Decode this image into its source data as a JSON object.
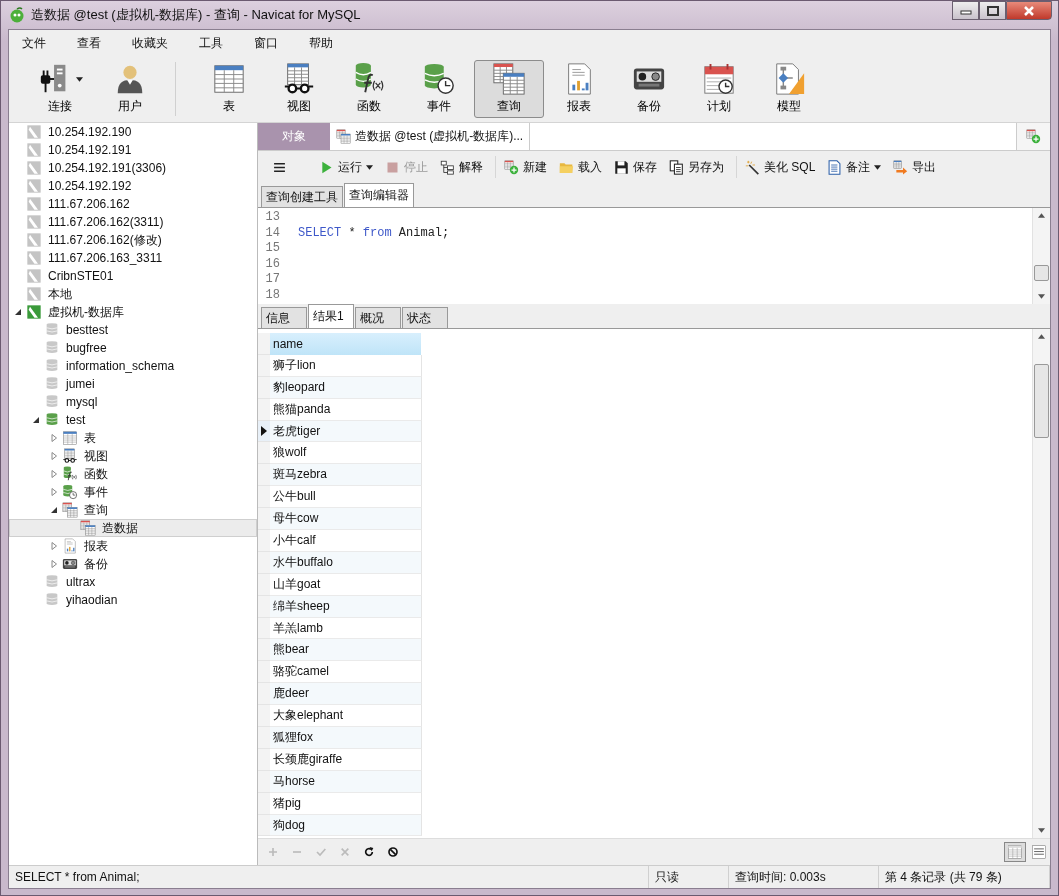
{
  "window": {
    "title": "造数据 @test (虚拟机-数据库) - 查询 - Navicat for MySQL"
  },
  "menu": [
    "文件",
    "查看",
    "收藏夹",
    "工具",
    "窗口",
    "帮助"
  ],
  "toolbar": {
    "groups": [
      [
        {
          "label": "连接",
          "kind": "connection",
          "dropdown": true,
          "selected": false
        },
        {
          "label": "用户",
          "kind": "user",
          "dropdown": false,
          "selected": false
        }
      ],
      [
        {
          "label": "表",
          "kind": "table",
          "dropdown": false,
          "selected": false
        },
        {
          "label": "视图",
          "kind": "view",
          "dropdown": false,
          "selected": false
        },
        {
          "label": "函数",
          "kind": "function",
          "dropdown": false,
          "selected": false
        },
        {
          "label": "事件",
          "kind": "event",
          "dropdown": false,
          "selected": false
        },
        {
          "label": "查询",
          "kind": "query",
          "dropdown": false,
          "selected": true
        },
        {
          "label": "报表",
          "kind": "report",
          "dropdown": false,
          "selected": false
        },
        {
          "label": "备份",
          "kind": "backup",
          "dropdown": false,
          "selected": false
        },
        {
          "label": "计划",
          "kind": "schedule",
          "dropdown": false,
          "selected": false
        },
        {
          "label": "模型",
          "kind": "model",
          "dropdown": false,
          "selected": false
        }
      ]
    ]
  },
  "sidebar": {
    "tree": [
      {
        "label": "10.254.192.190",
        "kind": "connection",
        "open": false,
        "selected": false
      },
      {
        "label": "10.254.192.191",
        "kind": "connection",
        "open": false,
        "selected": false
      },
      {
        "label": "10.254.192.191(3306)",
        "kind": "connection",
        "open": false,
        "selected": false
      },
      {
        "label": "10.254.192.192",
        "kind": "connection",
        "open": false,
        "selected": false
      },
      {
        "label": "111.67.206.162",
        "kind": "connection",
        "open": false,
        "selected": false
      },
      {
        "label": "111.67.206.162(3311)",
        "kind": "connection",
        "open": false,
        "selected": false
      },
      {
        "label": "111.67.206.162(修改)",
        "kind": "connection",
        "open": false,
        "selected": false
      },
      {
        "label": "111.67.206.163_3311",
        "kind": "connection",
        "open": false,
        "selected": false
      },
      {
        "label": "CribnSTE01",
        "kind": "connection",
        "open": false,
        "selected": false
      },
      {
        "label": "本地",
        "kind": "connection",
        "open": false,
        "selected": false
      },
      {
        "label": "虚拟机-数据库",
        "kind": "connection",
        "open": true,
        "selected": false,
        "expanded": true,
        "children": [
          {
            "label": "besttest",
            "kind": "database",
            "open": false,
            "selected": false
          },
          {
            "label": "bugfree",
            "kind": "database",
            "open": false,
            "selected": false
          },
          {
            "label": "information_schema",
            "kind": "database",
            "open": false,
            "selected": false
          },
          {
            "label": "jumei",
            "kind": "database",
            "open": false,
            "selected": false
          },
          {
            "label": "mysql",
            "kind": "database",
            "open": false,
            "selected": false
          },
          {
            "label": "test",
            "kind": "database",
            "open": true,
            "selected": false,
            "expanded": true,
            "children": [
              {
                "label": "表",
                "kind": "table",
                "selected": false,
                "expanded": false
              },
              {
                "label": "视图",
                "kind": "view",
                "selected": false,
                "expanded": false
              },
              {
                "label": "函数",
                "kind": "function",
                "selected": false,
                "expanded": false
              },
              {
                "label": "事件",
                "kind": "event",
                "selected": false,
                "expanded": false
              },
              {
                "label": "查询",
                "kind": "query",
                "selected": false,
                "expanded": true,
                "children": [
                  {
                    "label": "造数据",
                    "kind": "query",
                    "selected": true
                  }
                ]
              },
              {
                "label": "报表",
                "kind": "report",
                "selected": false,
                "expanded": false
              },
              {
                "label": "备份",
                "kind": "backup",
                "selected": false,
                "expanded": false
              }
            ]
          },
          {
            "label": "ultrax",
            "kind": "database",
            "open": false,
            "selected": false
          },
          {
            "label": "yihaodian",
            "kind": "database",
            "open": false,
            "selected": false
          }
        ]
      }
    ]
  },
  "doc_tabs": [
    {
      "label": "对象",
      "kind": "object",
      "selected": false
    },
    {
      "label": "造数据 @test (虚拟机-数据库)...",
      "kind": "query",
      "selected": true
    }
  ],
  "query_toolbar": {
    "groups": [
      [
        {
          "kind": "menu",
          "dropdown": false
        },
        {
          "kind": "run",
          "label": "运行",
          "dropdown": true,
          "disabled": false
        },
        {
          "kind": "stop",
          "label": "停止",
          "dropdown": false,
          "disabled": true
        },
        {
          "kind": "explain",
          "label": "解释",
          "dropdown": false,
          "disabled": false
        }
      ],
      [
        {
          "kind": "new",
          "label": "新建",
          "dropdown": false,
          "disabled": false
        },
        {
          "kind": "load",
          "label": "载入",
          "dropdown": false,
          "disabled": false
        },
        {
          "kind": "save",
          "label": "保存",
          "dropdown": false,
          "disabled": false
        },
        {
          "kind": "saveas",
          "label": "另存为",
          "dropdown": false,
          "disabled": false
        }
      ],
      [
        {
          "kind": "beautify",
          "label": "美化 SQL",
          "dropdown": false,
          "disabled": false
        },
        {
          "kind": "comment",
          "label": "备注",
          "dropdown": true,
          "disabled": false
        },
        {
          "kind": "export",
          "label": "导出",
          "dropdown": false,
          "disabled": false
        }
      ]
    ]
  },
  "editor_tabs": [
    {
      "label": "查询创建工具",
      "selected": false
    },
    {
      "label": "查询编辑器",
      "selected": true
    }
  ],
  "editor": {
    "lines": [
      {
        "number": "13"
      },
      {
        "number": "14",
        "tokens": [
          {
            "text": "SELECT",
            "kind": "keyword"
          },
          {
            "text": " * ",
            "kind": "plain"
          },
          {
            "text": "from",
            "kind": "keyword"
          },
          {
            "text": " Animal;",
            "kind": "plain"
          }
        ]
      },
      {
        "number": "15"
      },
      {
        "number": "16"
      },
      {
        "number": "17"
      },
      {
        "number": "18"
      }
    ]
  },
  "result_tabs": [
    {
      "label": "信息",
      "selected": false
    },
    {
      "label": "结果1",
      "selected": true
    },
    {
      "label": "概况",
      "selected": false
    },
    {
      "label": "状态",
      "selected": false
    }
  ],
  "result_grid": {
    "columns": [
      "name"
    ],
    "rows": [
      {
        "cells": [
          "狮子lion"
        ],
        "current": false
      },
      {
        "cells": [
          "豹leopard"
        ],
        "current": false
      },
      {
        "cells": [
          "熊猫panda"
        ],
        "current": false
      },
      {
        "cells": [
          "老虎tiger"
        ],
        "current": true
      },
      {
        "cells": [
          "狼wolf"
        ],
        "current": false
      },
      {
        "cells": [
          "斑马zebra"
        ],
        "current": false
      },
      {
        "cells": [
          "公牛bull"
        ],
        "current": false
      },
      {
        "cells": [
          "母牛cow"
        ],
        "current": false
      },
      {
        "cells": [
          "小牛calf"
        ],
        "current": false
      },
      {
        "cells": [
          "水牛buffalo"
        ],
        "current": false
      },
      {
        "cells": [
          "山羊goat"
        ],
        "current": false
      },
      {
        "cells": [
          "绵羊sheep"
        ],
        "current": false
      },
      {
        "cells": [
          "羊羔lamb"
        ],
        "current": false
      },
      {
        "cells": [
          "熊bear"
        ],
        "current": false
      },
      {
        "cells": [
          "骆驼camel"
        ],
        "current": false
      },
      {
        "cells": [
          "鹿deer"
        ],
        "current": false
      },
      {
        "cells": [
          "大象elephant"
        ],
        "current": false
      },
      {
        "cells": [
          "狐狸fox"
        ],
        "current": false
      },
      {
        "cells": [
          "长颈鹿giraffe"
        ],
        "current": false
      },
      {
        "cells": [
          "马horse"
        ],
        "current": false
      },
      {
        "cells": [
          "猪pig"
        ],
        "current": false
      },
      {
        "cells": [
          "狗dog"
        ],
        "current": false
      }
    ]
  },
  "grid_toolbar": {
    "actions": [
      {
        "kind": "add",
        "disabled": true
      },
      {
        "kind": "remove",
        "disabled": true
      },
      {
        "kind": "apply",
        "disabled": true
      },
      {
        "kind": "cancel",
        "disabled": true
      },
      {
        "kind": "refresh",
        "disabled": false
      },
      {
        "kind": "halt",
        "disabled": false
      }
    ],
    "views": [
      {
        "kind": "grid",
        "selected": true
      },
      {
        "kind": "form",
        "selected": false
      }
    ]
  },
  "status_bar": [
    "SELECT * from Animal;",
    "只读",
    "查询时间: 0.003s",
    "第 4 条记录 (共 79 条)"
  ]
}
